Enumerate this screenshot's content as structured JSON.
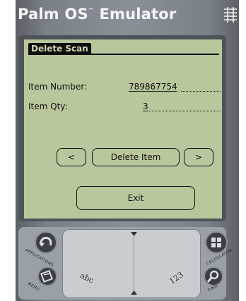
{
  "window": {
    "title_main": "Palm OS",
    "title_tm": "™",
    "title_rest": " Emulator"
  },
  "form": {
    "title": "Delete Scan",
    "item_number_label": "Item Number:",
    "item_number_value": "789867754",
    "item_qty_label": "Item Qty:",
    "item_qty_value": "3"
  },
  "buttons": {
    "prev_label": "<",
    "delete_label": "Delete Item",
    "next_label": ">",
    "exit_label": "Exit"
  },
  "silkscreen": {
    "applications_label": "APPLICATIONS",
    "menu_label": "MENU",
    "calculator_label": "CALCULATOR",
    "find_label": "FIND",
    "graffiti_letters": "abc",
    "graffiti_numbers": "123"
  },
  "colors": {
    "screen_bg": "#b8c79c",
    "device_body": "#7b8189"
  }
}
